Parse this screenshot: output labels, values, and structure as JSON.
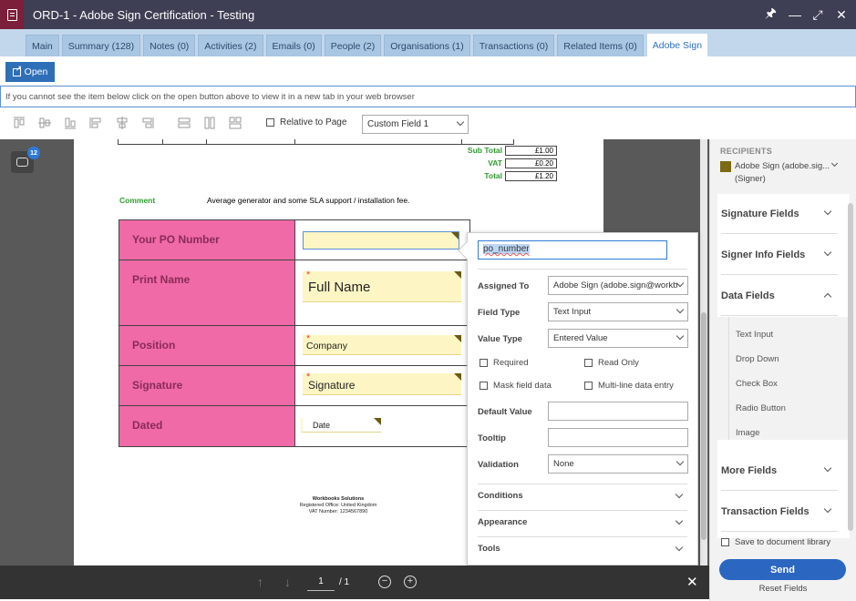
{
  "window": {
    "title": "ORD-1 - Adobe Sign Certification - Testing"
  },
  "tabs": [
    {
      "label": "Main"
    },
    {
      "label": "Summary (128)"
    },
    {
      "label": "Notes (0)"
    },
    {
      "label": "Activities (2)"
    },
    {
      "label": "Emails (0)"
    },
    {
      "label": "People (2)"
    },
    {
      "label": "Organisations (1)"
    },
    {
      "label": "Transactions (0)"
    },
    {
      "label": "Related Items (0)"
    },
    {
      "label": "Adobe Sign",
      "active": true
    }
  ],
  "open_button": {
    "label": "Open"
  },
  "info_text": "If you cannot see the item below click on the open button above to view it in a new tab in your web browser",
  "toolbar": {
    "relative_label": "Relative to Page",
    "field_select": "Custom Field 1"
  },
  "comments": {
    "count": "12"
  },
  "document": {
    "totals": [
      {
        "label": "Sub Total",
        "value": "£1.00"
      },
      {
        "label": "VAT",
        "value": "£0.20"
      },
      {
        "label": "Total",
        "value": "£1.20"
      }
    ],
    "comment_label": "Comment",
    "comment_text": "Average generator and some SLA support / installation fee.",
    "form_rows": [
      {
        "label": "Your PO Number",
        "field": ""
      },
      {
        "label": "Print Name",
        "field": "Full Name"
      },
      {
        "label": "Position",
        "field": "Company"
      },
      {
        "label": "Signature",
        "field": "Signature"
      },
      {
        "label": "Dated",
        "field": "Date"
      }
    ],
    "footer": [
      "Workbooks Solutions",
      "Registered Office: United Kingdom",
      "VAT Number: 1234567890"
    ]
  },
  "properties": {
    "field_name": "po_number",
    "assigned_to_label": "Assigned To",
    "assigned_to_value": "Adobe Sign (adobe.sign@workb",
    "field_type_label": "Field Type",
    "field_type_value": "Text Input",
    "value_type_label": "Value Type",
    "value_type_value": "Entered Value",
    "required_label": "Required",
    "read_only_label": "Read Only",
    "mask_label": "Mask field data",
    "multiline_label": "Multi-line data entry",
    "default_value_label": "Default Value",
    "tooltip_label": "Tooltip",
    "validation_label": "Validation",
    "validation_value": "None",
    "sections": [
      "Conditions",
      "Appearance",
      "Tools"
    ]
  },
  "pager": {
    "current": "1",
    "total": "/ 1"
  },
  "sidebar": {
    "recipients_header": "RECIPIENTS",
    "recipient_name": "Adobe Sign (adobe.sig... (Signer)",
    "recipient_color": "#7a6a12",
    "sections": [
      "Signature Fields",
      "Signer Info Fields",
      "Data Fields",
      "More Fields",
      "Transaction Fields"
    ],
    "data_fields": [
      "Text Input",
      "Drop Down",
      "Check Box",
      "Radio Button",
      "Image"
    ],
    "save_library_label": "Save to document library",
    "send_label": "Send",
    "reset_label": "Reset Fields"
  }
}
